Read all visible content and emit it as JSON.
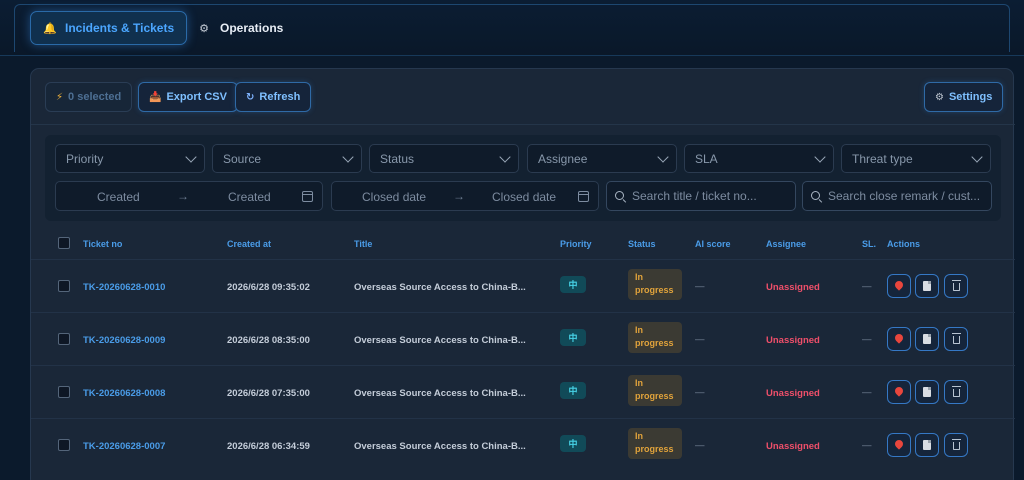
{
  "nav": {
    "tabs": [
      {
        "label": "Incidents & Tickets",
        "icon": "bell-icon"
      },
      {
        "label": "Operations",
        "icon": "gear-icon"
      }
    ]
  },
  "toolbar": {
    "selected": "0 selected",
    "export_label": "Export CSV",
    "refresh_label": "Refresh",
    "settings_label": "Settings"
  },
  "filters": {
    "priority": "Priority",
    "source": "Source",
    "status": "Status",
    "assignee": "Assignee",
    "sla": "SLA",
    "threat_type": "Threat type",
    "created_start": "Created",
    "created_end": "Created",
    "closed_start": "Closed date",
    "closed_end": "Closed date",
    "arrow": "→",
    "search_title_placeholder": "Search title / ticket no...",
    "search_remark_placeholder": "Search close remark / cust..."
  },
  "table": {
    "columns": {
      "ticket_no": "Ticket no",
      "created_at": "Created at",
      "title": "Title",
      "priority": "Priority",
      "status": "Status",
      "ai_score": "AI score",
      "assignee": "Assignee",
      "sla": "SL.",
      "actions": "Actions"
    },
    "rows": [
      {
        "ticket_no": "TK-20260628-0010",
        "created_at": "2026/6/28 09:35:02",
        "title": "Overseas Source Access to China-B...",
        "priority": "中",
        "status_line1": "In",
        "status_line2": "progress",
        "ai_score": "—",
        "assignee": "Unassigned",
        "sla": "—"
      },
      {
        "ticket_no": "TK-20260628-0009",
        "created_at": "2026/6/28 08:35:00",
        "title": "Overseas Source Access to China-B...",
        "priority": "中",
        "status_line1": "In",
        "status_line2": "progress",
        "ai_score": "—",
        "assignee": "Unassigned",
        "sla": "—"
      },
      {
        "ticket_no": "TK-20260628-0008",
        "created_at": "2026/6/28 07:35:00",
        "title": "Overseas Source Access to China-B...",
        "priority": "中",
        "status_line1": "In",
        "status_line2": "progress",
        "ai_score": "—",
        "assignee": "Unassigned",
        "sla": "—"
      },
      {
        "ticket_no": "TK-20260628-0007",
        "created_at": "2026/6/28 06:34:59",
        "title": "Overseas Source Access to China-B...",
        "priority": "中",
        "status_line1": "In",
        "status_line2": "progress",
        "ai_score": "—",
        "assignee": "Unassigned",
        "sla": "—"
      }
    ]
  },
  "colors": {
    "accent": "#4a9ce8",
    "unassigned": "#ef4f6a",
    "status_in_progress": "#e1a33b",
    "priority_badge": "#47d4e8"
  }
}
